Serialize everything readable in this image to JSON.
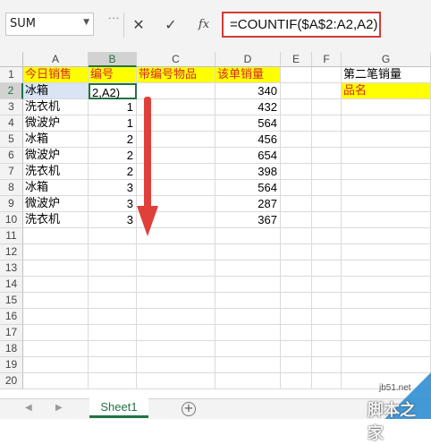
{
  "name_box": {
    "value": "SUM"
  },
  "formula_bar": {
    "cancel_icon": "✕",
    "enter_icon": "✓",
    "fx_label": "fx",
    "formula": "=COUNTIF($A$2:A2,A2)"
  },
  "columns": [
    "A",
    "B",
    "C",
    "D",
    "E",
    "F",
    "G"
  ],
  "rows": [
    "1",
    "2",
    "3",
    "4",
    "5",
    "6",
    "7",
    "8",
    "9",
    "10",
    "11",
    "12",
    "13",
    "14",
    "15",
    "16",
    "17",
    "18",
    "19",
    "20"
  ],
  "headers": {
    "A1": "今日销售",
    "B1": "编号",
    "C1": "带编号物品",
    "D1": "该单销量",
    "G1": "第二笔销量",
    "G2": "品名"
  },
  "editing_cell": {
    "ref": "B2",
    "text": "2,A2)"
  },
  "data_rows": [
    {
      "item": "冰箱",
      "num": "",
      "sales": "340"
    },
    {
      "item": "洗衣机",
      "num": "1",
      "sales": "432"
    },
    {
      "item": "微波炉",
      "num": "1",
      "sales": "564"
    },
    {
      "item": "冰箱",
      "num": "2",
      "sales": "456"
    },
    {
      "item": "微波炉",
      "num": "2",
      "sales": "654"
    },
    {
      "item": "洗衣机",
      "num": "2",
      "sales": "398"
    },
    {
      "item": "冰箱",
      "num": "3",
      "sales": "564"
    },
    {
      "item": "微波炉",
      "num": "3",
      "sales": "287"
    },
    {
      "item": "洗衣机",
      "num": "3",
      "sales": "367"
    }
  ],
  "sheet_tab": {
    "label": "Sheet1"
  },
  "add_sheet_icon": "+",
  "watermark": {
    "line1": "jb51.net",
    "line2": "脚本之家"
  },
  "colors": {
    "accent_green": "#217346",
    "highlight_yellow": "#ffff00",
    "header_red_text": "#d7262b",
    "arrow_red": "#e0403a"
  }
}
